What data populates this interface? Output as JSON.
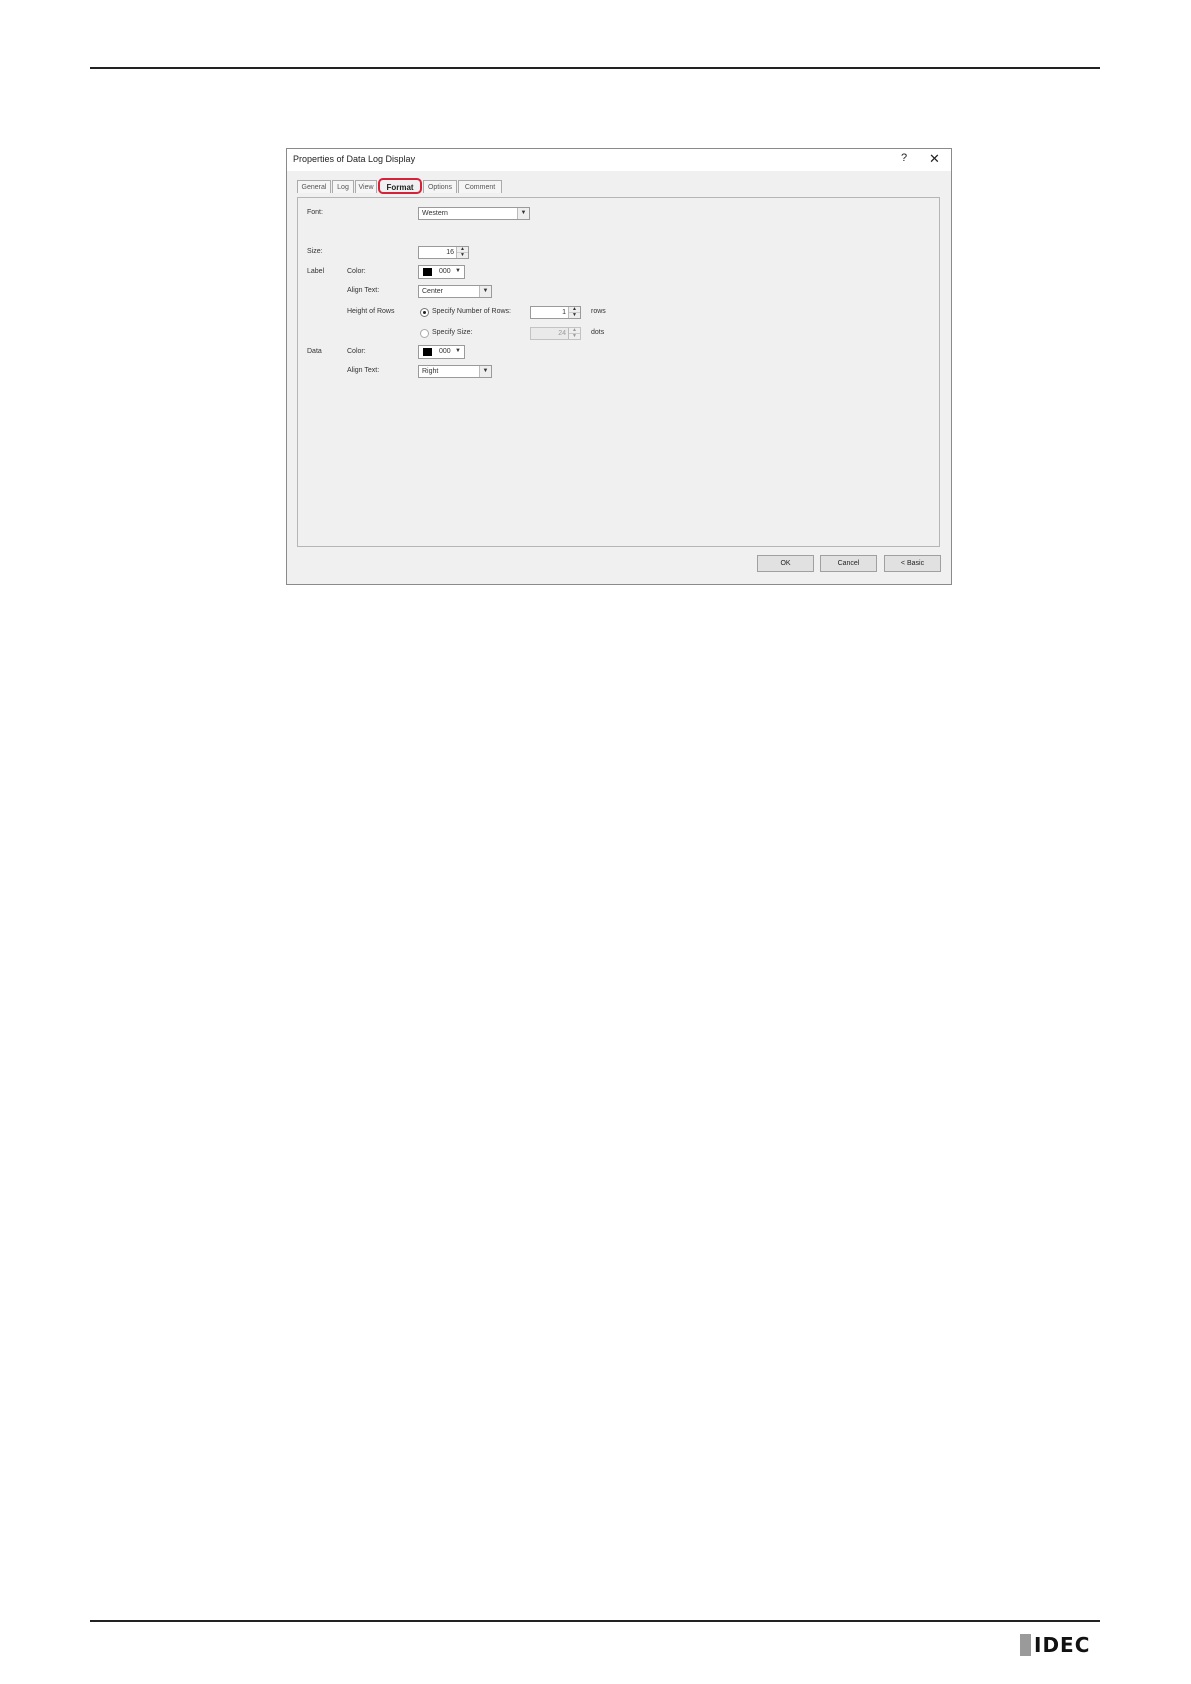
{
  "dialog": {
    "title": "Properties of Data Log Display",
    "help_glyph": "?",
    "close_glyph": "✕"
  },
  "tabs": [
    {
      "label": "General"
    },
    {
      "label": "Log"
    },
    {
      "label": "View"
    },
    {
      "label": "Format"
    },
    {
      "label": "Options"
    },
    {
      "label": "Comment"
    }
  ],
  "active_tab": "Format",
  "format": {
    "font_label": "Font:",
    "font_value": "Western",
    "size_label": "Size:",
    "size_value": "16",
    "label_section": "Label",
    "label_color_label": "Color:",
    "label_color_value": "000",
    "label_align_label": "Align Text:",
    "label_align_value": "Center",
    "height_rows_label": "Height of Rows",
    "specify_rows_label": "Specify Number of Rows:",
    "rows_value": "1",
    "rows_unit": "rows",
    "specify_size_label": "Specify Size:",
    "size_dots_value": "24",
    "dots_unit": "dots",
    "data_section": "Data",
    "data_color_label": "Color:",
    "data_color_value": "000",
    "data_align_label": "Align Text:",
    "data_align_value": "Right"
  },
  "buttons": {
    "ok": "OK",
    "cancel": "Cancel",
    "basic": "< Basic"
  },
  "brand": {
    "logo_text": "IDEC"
  },
  "colors": {
    "highlight": "#d6213a",
    "swatch": "#000000"
  }
}
